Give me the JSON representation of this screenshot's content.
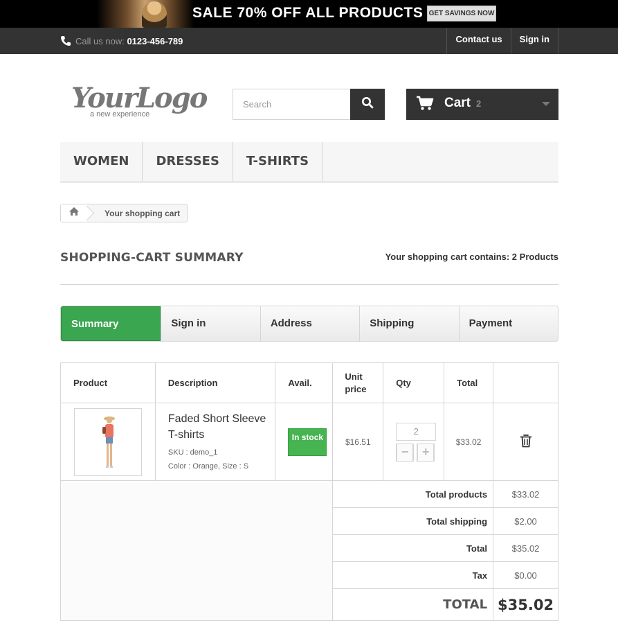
{
  "banner": {
    "headline": "SALE 70% OFF ALL PRODUCTS",
    "cta": "GET SAVINGS NOW"
  },
  "nav": {
    "phone_label": "Call us now:",
    "phone_number": "0123-456-789",
    "contact": "Contact us",
    "signin": "Sign in"
  },
  "header": {
    "logo_main": "YourLogo",
    "logo_tag": "a new experience",
    "search_placeholder": "Search",
    "cart_label": "Cart",
    "cart_count": "2"
  },
  "menu": [
    "WOMEN",
    "DRESSES",
    "T-SHIRTS"
  ],
  "breadcrumb": {
    "current": "Your shopping cart"
  },
  "page": {
    "title": "SHOPPING-CART SUMMARY",
    "count_text": "Your shopping cart contains: 2 Products"
  },
  "steps": [
    "Summary",
    "Sign in",
    "Address",
    "Shipping",
    "Payment"
  ],
  "table": {
    "headers": {
      "product": "Product",
      "description": "Description",
      "avail": "Avail.",
      "unit_price": "Unit price",
      "qty": "Qty",
      "total": "Total"
    },
    "item": {
      "name": "Faded Short Sleeve T-shirts",
      "sku": "SKU : demo_1",
      "attrs": "Color : Orange, Size : S",
      "availability": "In stock",
      "unit_price": "$16.51",
      "qty": "2",
      "total": "$33.02"
    },
    "totals": {
      "products_label": "Total products",
      "products_value": "$33.02",
      "shipping_label": "Total shipping",
      "shipping_value": "$2.00",
      "total_label": "Total",
      "total_value": "$35.02",
      "tax_label": "Tax",
      "tax_value": "$0.00",
      "grand_label": "TOTAL",
      "grand_value": "$35.02"
    }
  },
  "colors": {
    "accent_green": "#3aa64f",
    "dark": "#333333"
  }
}
